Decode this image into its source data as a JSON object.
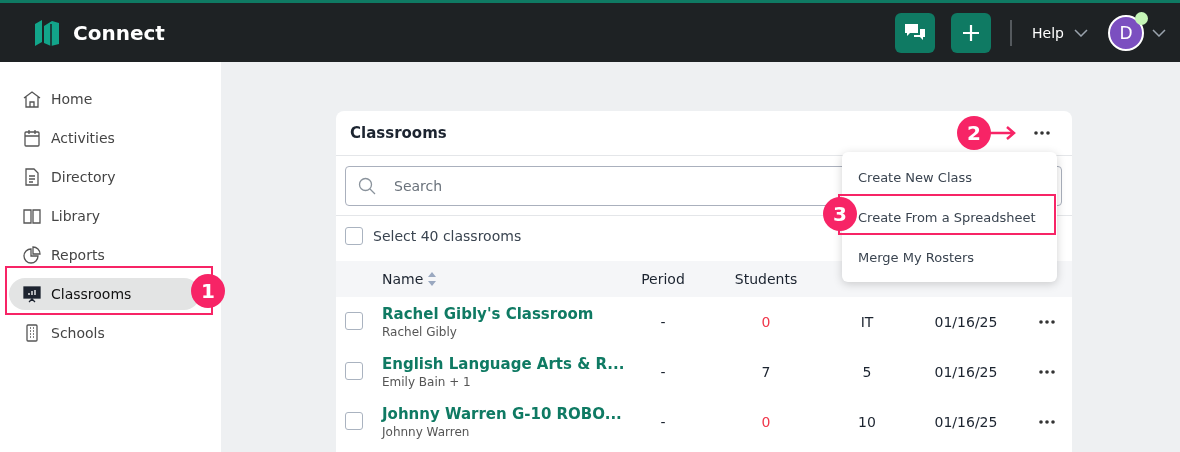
{
  "app": {
    "title": "Connect",
    "help": "Help",
    "avatar": "D",
    "online": true
  },
  "sidebar": {
    "items": [
      {
        "label": "Home",
        "kind": "home",
        "selected": false
      },
      {
        "label": "Activities",
        "kind": "calendar",
        "selected": false
      },
      {
        "label": "Directory",
        "kind": "document",
        "selected": false
      },
      {
        "label": "Library",
        "kind": "book",
        "selected": false
      },
      {
        "label": "Reports",
        "kind": "pie",
        "selected": false
      },
      {
        "label": "Classrooms",
        "kind": "board",
        "selected": true
      },
      {
        "label": "Schools",
        "kind": "building",
        "selected": false
      }
    ]
  },
  "card": {
    "title": "Classrooms",
    "search": {
      "placeholder": "Search"
    },
    "select_all": {
      "label": "Select 40 classrooms",
      "checked": false
    },
    "columns": [
      {
        "label": "Name",
        "sortable": true
      },
      {
        "label": "Period",
        "sortable": false
      },
      {
        "label": "Students",
        "sortable": false
      }
    ],
    "rows": [
      {
        "name": "Rachel Gibly's Classroom",
        "teacher": "Rachel Gibly",
        "period": "-",
        "students": "0",
        "students_warning": true,
        "column_4": "IT",
        "column_5": "01/16/25",
        "checked": false
      },
      {
        "name": "English Language Arts & R...",
        "teacher": "Emily Bain + 1",
        "period": "-",
        "students": "7",
        "students_warning": false,
        "column_4": "5",
        "column_5": "01/16/25",
        "checked": false
      },
      {
        "name": "Johnny Warren G-10 ROBO...",
        "teacher": "Johnny Warren",
        "period": "-",
        "students": "0",
        "students_warning": true,
        "column_4": "10",
        "column_5": "01/16/25",
        "checked": false
      }
    ],
    "menu": {
      "items": [
        {
          "label": "Create New Class"
        },
        {
          "label": "Create From a Spreadsheet"
        },
        {
          "label": "Merge My Rosters"
        }
      ]
    }
  },
  "annotations": [
    {
      "label": "1",
      "kind": "frame"
    },
    {
      "label": "2",
      "kind": "arrow"
    },
    {
      "label": "3",
      "kind": "frame"
    }
  ]
}
